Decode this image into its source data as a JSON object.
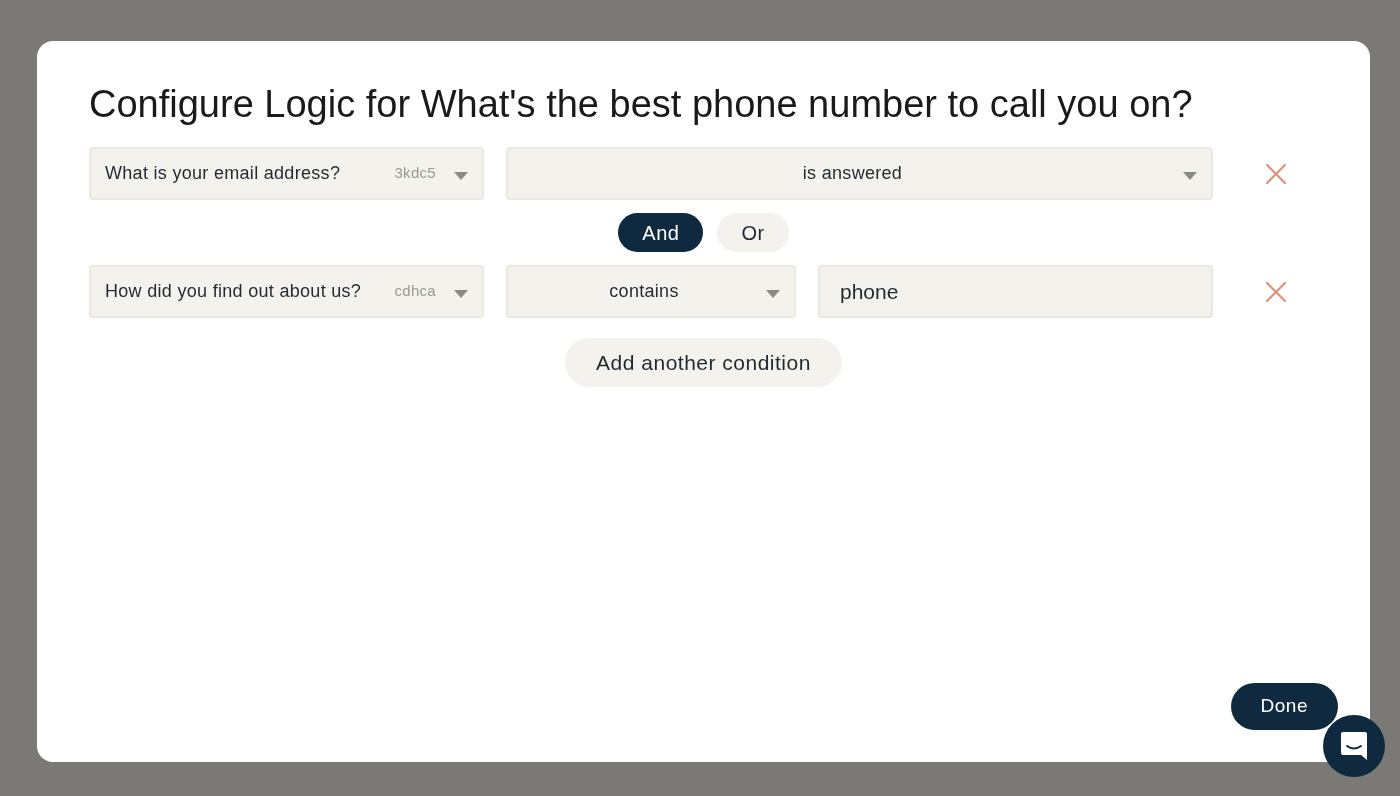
{
  "dialog": {
    "title": "Configure Logic for What's the best phone number to call you on?",
    "conditions": [
      {
        "question": {
          "label": "What is your email address?",
          "ref": "3kdc5"
        },
        "operator": "is answered"
      },
      {
        "question": {
          "label": "How did you find out about us?",
          "ref": "cdhca"
        },
        "operator": "contains",
        "value": "phone"
      }
    ],
    "joiners": [
      {
        "label": "And",
        "selected": true
      },
      {
        "label": "Or",
        "selected": false
      }
    ],
    "add_button": "Add another condition",
    "done_button": "Done"
  }
}
